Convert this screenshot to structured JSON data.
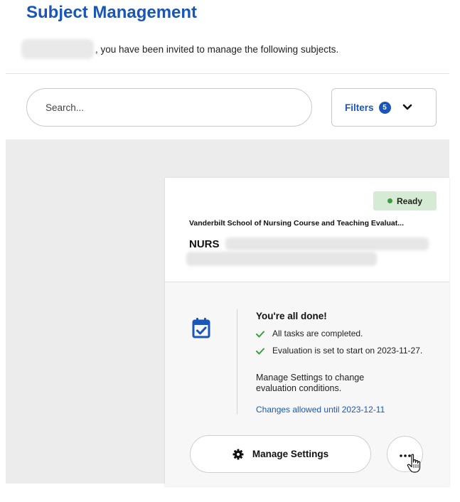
{
  "page": {
    "title": "Subject Management",
    "invite_text": ", you have been invited to manage the following subjects."
  },
  "search": {
    "placeholder": "Search..."
  },
  "filters": {
    "label": "Filters",
    "count": "5",
    "icon": "chevron-down-icon"
  },
  "card": {
    "status": "Ready",
    "status_color": "#3f9a44",
    "course_title": "Vanderbilt School of Nursing Course and Teaching Evaluat...",
    "subject_code": "NURS",
    "done_title": "You're all done!",
    "tasks": [
      "All tasks are completed.",
      "Evaluation is set to start on 2023-11-27."
    ],
    "manage_note": "Manage Settings to change evaluation conditions.",
    "changes_until": "Changes allowed until 2023-12-11",
    "manage_button": "Manage Settings",
    "more_icon": "ellipsis-icon"
  },
  "colors": {
    "accent": "#1a56b8",
    "ready_bg": "#d6ebd3"
  }
}
